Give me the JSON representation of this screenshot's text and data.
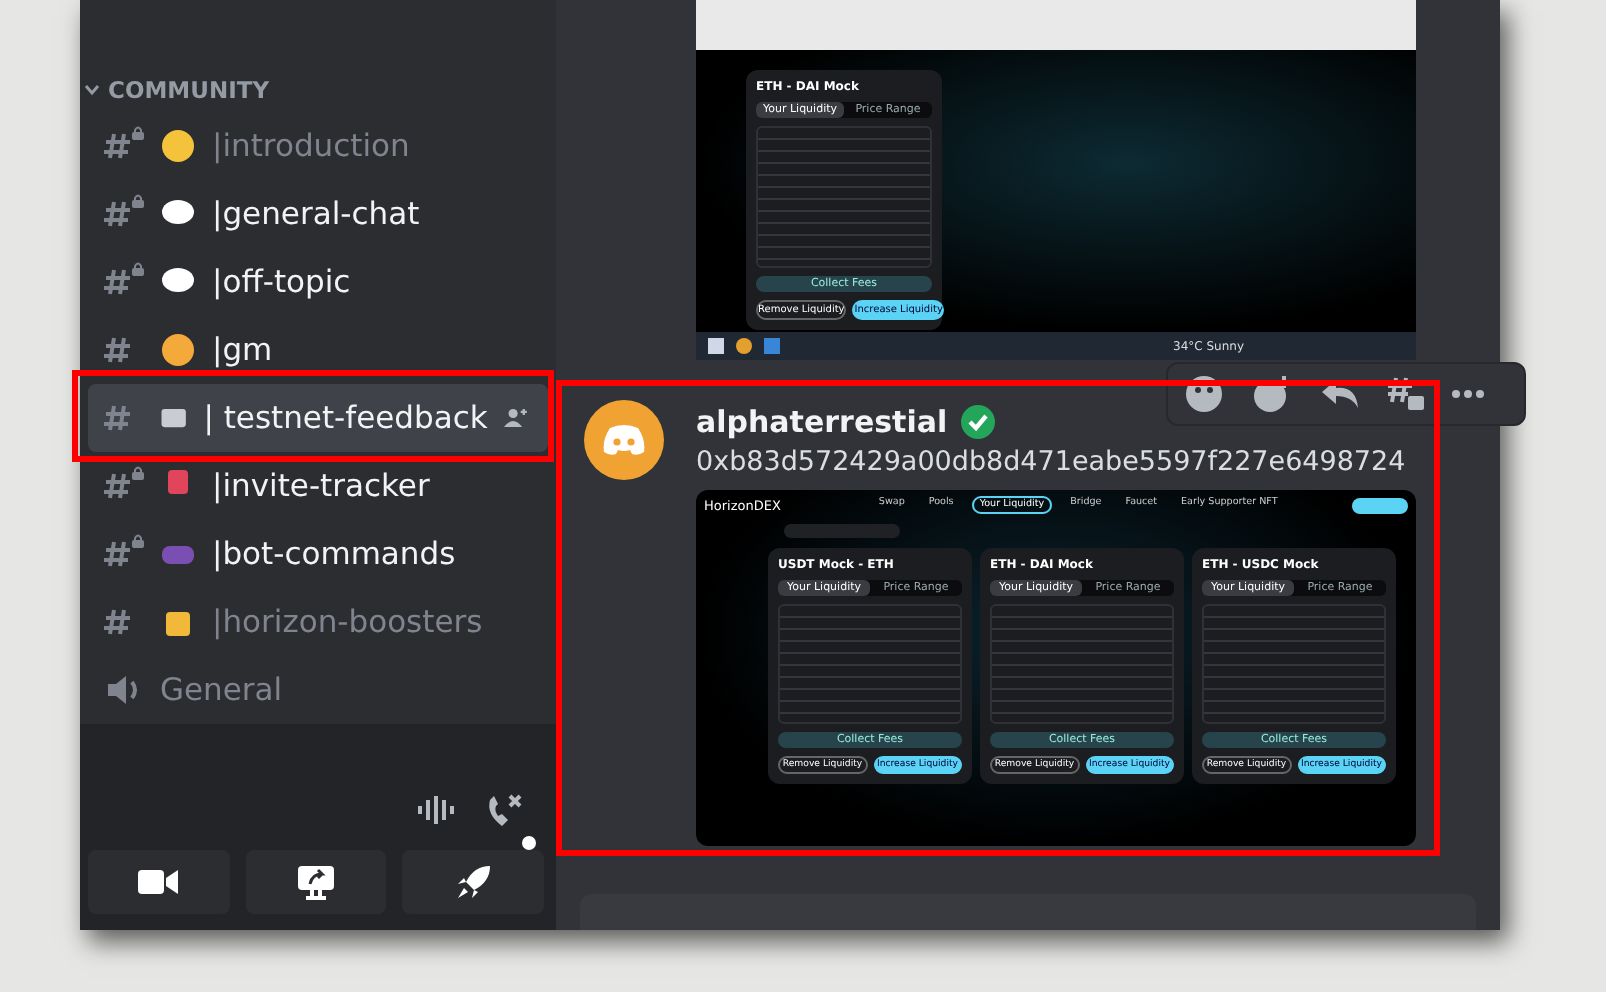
{
  "sidebar": {
    "category": "COMMUNITY",
    "channels": [
      {
        "kind": "text",
        "name": "|introduction",
        "locked": true,
        "unread": false,
        "selected": false
      },
      {
        "kind": "text",
        "name": "|general-chat",
        "locked": true,
        "unread": true,
        "selected": false
      },
      {
        "kind": "text",
        "name": "|off-topic",
        "locked": true,
        "unread": true,
        "selected": false
      },
      {
        "kind": "text",
        "name": "|gm",
        "locked": false,
        "unread": true,
        "selected": false
      },
      {
        "kind": "text",
        "name": "| testnet-feedback",
        "locked": false,
        "unread": true,
        "selected": true
      },
      {
        "kind": "text",
        "name": "|invite-tracker",
        "locked": true,
        "unread": true,
        "selected": false
      },
      {
        "kind": "text",
        "name": "|bot-commands",
        "locked": true,
        "unread": true,
        "selected": false
      },
      {
        "kind": "text",
        "name": "|horizon-boosters",
        "locked": false,
        "unread": false,
        "selected": false
      },
      {
        "kind": "voice",
        "name": "General",
        "unread": false,
        "selected": false
      }
    ]
  },
  "top_embed": {
    "card_title": "ETH - DAI Mock",
    "tabs": [
      {
        "label": "Your Liquidity",
        "selected": true
      },
      {
        "label": "Price Range",
        "selected": false
      }
    ],
    "collect": "Collect Fees",
    "buttons": [
      "Remove Liquidity",
      "Increase Liquidity"
    ],
    "weather": "34°C Sunny"
  },
  "message": {
    "author": "alphaterrestial",
    "verified": true,
    "text": "0xb83d572429a00db8d471eabe5597f227e6498724"
  },
  "bottom_embed": {
    "brand": "HorizonDEX",
    "nav": [
      {
        "label": "Swap",
        "selected": false
      },
      {
        "label": "Pools",
        "selected": false
      },
      {
        "label": "Your Liquidity",
        "selected": true
      },
      {
        "label": "Bridge",
        "selected": false
      },
      {
        "label": "Faucet",
        "selected": false
      },
      {
        "label": "Early Supporter NFT",
        "selected": false
      }
    ],
    "cards": [
      {
        "title": "USDT Mock - ETH",
        "tabs": [
          {
            "label": "Your Liquidity",
            "selected": true
          },
          {
            "label": "Price Range",
            "selected": false
          }
        ],
        "collect": "Collect Fees",
        "buttons": [
          "Remove Liquidity",
          "Increase Liquidity"
        ]
      },
      {
        "title": "ETH - DAI Mock",
        "tabs": [
          {
            "label": "Your Liquidity",
            "selected": true
          },
          {
            "label": "Price Range",
            "selected": false
          }
        ],
        "collect": "Collect Fees",
        "buttons": [
          "Remove Liquidity",
          "Increase Liquidity"
        ]
      },
      {
        "title": "ETH - USDC Mock",
        "tabs": [
          {
            "label": "Your Liquidity",
            "selected": true
          },
          {
            "label": "Price Range",
            "selected": false
          }
        ],
        "collect": "Collect Fees",
        "buttons": [
          "Remove Liquidity",
          "Increase Liquidity"
        ]
      }
    ]
  }
}
